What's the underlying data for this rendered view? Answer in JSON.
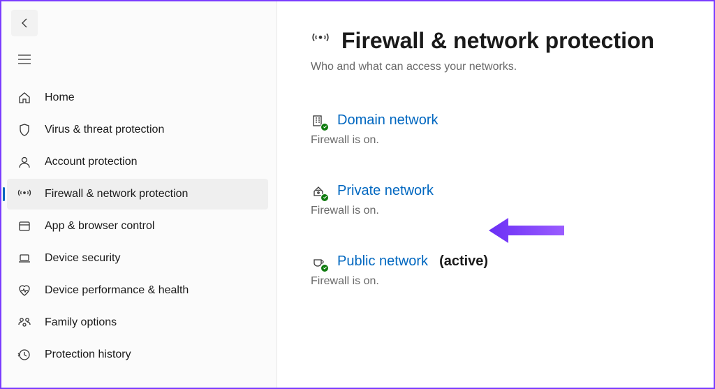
{
  "sidebar": {
    "items": [
      {
        "label": "Home"
      },
      {
        "label": "Virus & threat protection"
      },
      {
        "label": "Account protection"
      },
      {
        "label": "Firewall & network protection"
      },
      {
        "label": "App & browser control"
      },
      {
        "label": "Device security"
      },
      {
        "label": "Device performance & health"
      },
      {
        "label": "Family options"
      },
      {
        "label": "Protection history"
      }
    ]
  },
  "main": {
    "title": "Firewall & network protection",
    "subtitle": "Who and what can access your networks.",
    "networks": [
      {
        "title": "Domain network",
        "status": "Firewall is on.",
        "active": ""
      },
      {
        "title": "Private network",
        "status": "Firewall is on.",
        "active": ""
      },
      {
        "title": "Public network",
        "status": "Firewall is on.",
        "active": "(active)"
      }
    ]
  }
}
